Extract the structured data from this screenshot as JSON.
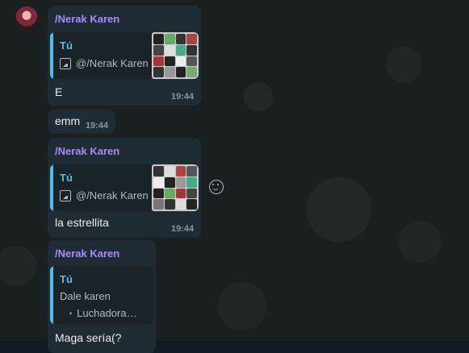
{
  "messages": [
    {
      "sender": "/Nerak Karen",
      "quote_author": "Tú",
      "quote_text": "@/Nerak Karen",
      "text": "E",
      "time": "19:44"
    },
    {
      "text": "emm",
      "time": "19:44"
    },
    {
      "sender": "/Nerak Karen",
      "quote_author": "Tú",
      "quote_text": "@/Nerak Karen",
      "text": "la estrellita",
      "time": "19:44"
    },
    {
      "sender": "/Nerak Karen",
      "quote_author": "Tú",
      "quote_text": "Dale karen",
      "quote_sub": "Luchadora…",
      "text": "Maga sería(?"
    }
  ],
  "icons": {
    "emoji": "smiley-icon",
    "image": "image-icon",
    "avatar": "avatar"
  },
  "colors": {
    "sender": "#a78bfa",
    "quote_accent": "#53bdeb",
    "bubble": "#202c33"
  }
}
